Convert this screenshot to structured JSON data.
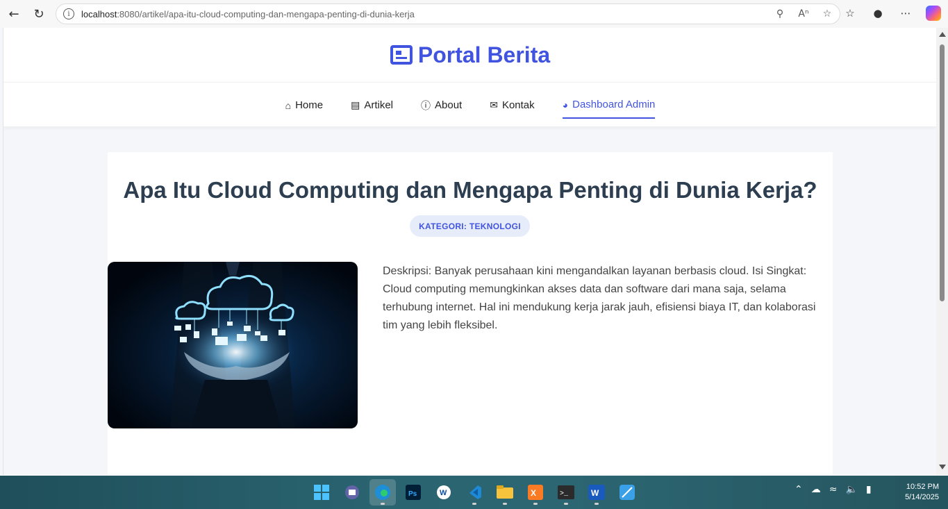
{
  "browser": {
    "url_host": "localhost",
    "url_path": ":8080/artikel/apa-itu-cloud-computing-dan-mengapa-penting-di-dunia-kerja"
  },
  "site": {
    "brand": "Portal Berita",
    "nav": [
      {
        "label": "Home",
        "icon": "home-icon"
      },
      {
        "label": "Artikel",
        "icon": "newspaper-icon"
      },
      {
        "label": "About",
        "icon": "info-icon"
      },
      {
        "label": "Kontak",
        "icon": "envelope-icon"
      },
      {
        "label": "Dashboard Admin",
        "icon": "dashboard-icon",
        "active": true
      }
    ],
    "accent": "#4154e0"
  },
  "article": {
    "title": "Apa Itu Cloud Computing dan Mengapa Penting di Dunia Kerja?",
    "category": "KATEGORI: TEKNOLOGI",
    "body": "Deskripsi: Banyak perusahaan kini mengandalkan layanan berbasis cloud. Isi Singkat: Cloud computing memungkinkan akses data dan software dari mana saja, selama terhubung internet. Hal ini mendukung kerja jarak jauh, efisiensi biaya IT, dan kolaborasi tim yang lebih fleksibel."
  },
  "taskbar": {
    "time": "10:52 PM",
    "date": "5/14/2025",
    "apps": [
      "windows-start-icon",
      "teams-icon",
      "edge-icon",
      "photoshop-icon",
      "wps-icon",
      "vscode-icon",
      "file-explorer-icon",
      "xampp-icon",
      "terminal-icon",
      "word-icon",
      "snipping-tool-icon"
    ]
  }
}
